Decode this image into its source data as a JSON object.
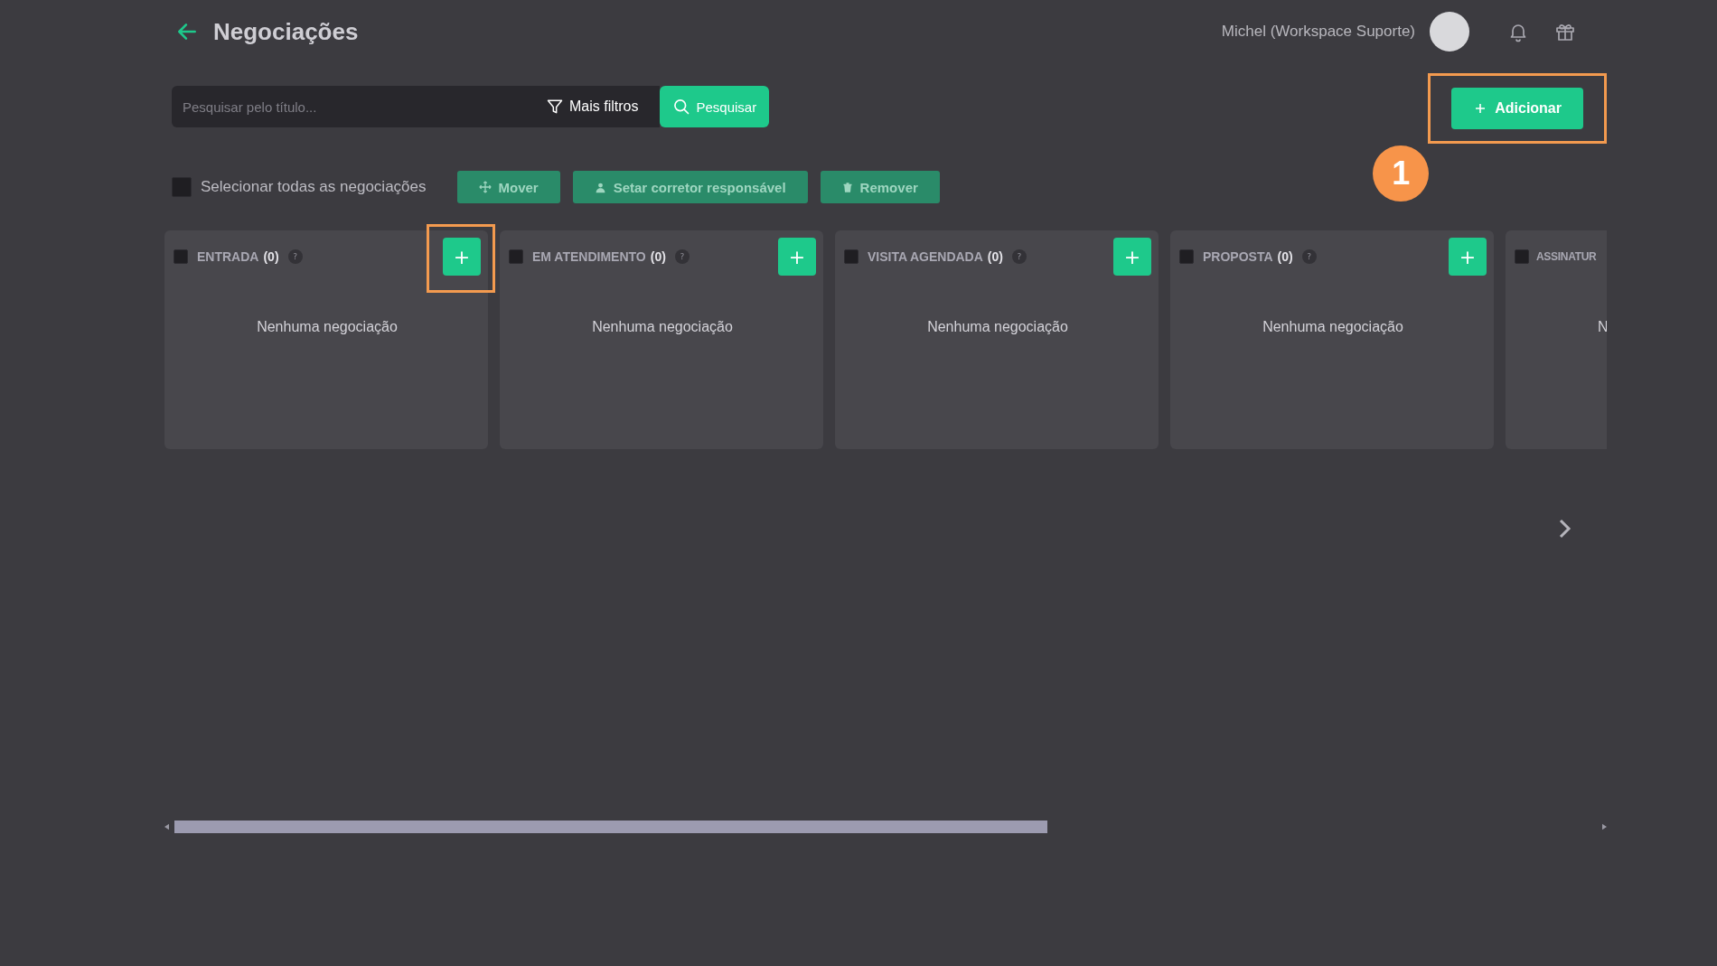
{
  "header": {
    "title": "Negociações",
    "user": "Michel (Workspace Suporte)"
  },
  "search": {
    "placeholder": "Pesquisar pelo título...",
    "filters_label": "Mais filtros",
    "search_label": "Pesquisar"
  },
  "add_button": {
    "label": "Adicionar",
    "highlighted": true
  },
  "annotation_badge": "1",
  "select_all": {
    "label": "Selecionar todas as negociações",
    "checked": false
  },
  "bulk_actions": [
    {
      "label": "Mover",
      "kind": "move"
    },
    {
      "label": "Setar corretor responsável",
      "kind": "assign"
    },
    {
      "label": "Remover",
      "kind": "remove"
    }
  ],
  "columns": [
    {
      "kind": "full",
      "title": "ENTRADA",
      "count": "(0)",
      "help": "?",
      "add": "+",
      "add_highlighted": true,
      "checked": false,
      "empty_text": "Nenhuma negociação"
    },
    {
      "kind": "full",
      "title": "EM ATENDIMENTO",
      "count": "(0)",
      "help": "?",
      "add": "+",
      "add_highlighted": false,
      "checked": false,
      "empty_text": "Nenhuma negociação"
    },
    {
      "kind": "full",
      "title": "VISITA AGENDADA",
      "count": "(0)",
      "help": "?",
      "add": "+",
      "add_highlighted": false,
      "checked": false,
      "empty_text": "Nenhuma negociação"
    },
    {
      "kind": "full",
      "title": "PROPOSTA",
      "count": "(0)",
      "help": "?",
      "add": "+",
      "add_highlighted": false,
      "checked": false,
      "empty_text": "Nenhuma negociação"
    },
    {
      "kind": "partial",
      "title": "ASSINATUR",
      "checked": false,
      "empty_text": "N"
    }
  ]
}
